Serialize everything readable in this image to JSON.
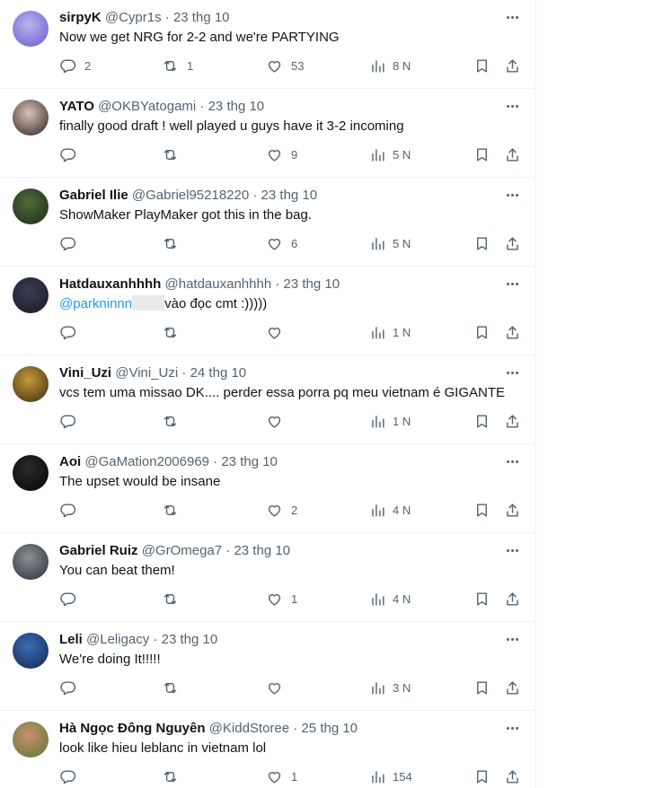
{
  "tweets": [
    {
      "name": "sirpyK",
      "handle": "@Cypr1s",
      "date": "23 thg 10",
      "text": "Now we get NRG for 2-2 and we're PARTYING",
      "replies": "2",
      "retweets": "1",
      "likes": "53",
      "views": "8 N",
      "avatar_colors": [
        "#b9b3f0",
        "#6a5acd"
      ]
    },
    {
      "name": "YATO",
      "handle": "@OKBYatogami",
      "date": "23 thg 10",
      "text": "finally good draft ! well played u guys have it 3-2 incoming",
      "replies": "",
      "retweets": "",
      "likes": "9",
      "views": "5 N",
      "avatar_colors": [
        "#d9c2b8",
        "#2b2020"
      ]
    },
    {
      "name": "Gabriel Ilie",
      "handle": "@Gabriel95218220",
      "date": "23 thg 10",
      "text": "ShowMaker PlayMaker got this in the bag.",
      "replies": "",
      "retweets": "",
      "likes": "6",
      "views": "5 N",
      "avatar_colors": [
        "#4f6b3a",
        "#1e2a18"
      ]
    },
    {
      "name": "Hatdauxanhhhh",
      "handle": "@hatdauxanhhhh",
      "date": "23 thg 10",
      "mention": "@parkninnn",
      "text": "vào đọc cmt :)))))",
      "replies": "",
      "retweets": "",
      "likes": "",
      "views": "1 N",
      "avatar_colors": [
        "#3a3d55",
        "#1a1a24"
      ]
    },
    {
      "name": "Vini_Uzi",
      "handle": "@Vini_Uzi",
      "date": "24 thg 10",
      "text": "vcs tem uma missao DK.... perder essa porra pq meu vietnam é GIGANTE",
      "replies": "",
      "retweets": "",
      "likes": "",
      "views": "1 N",
      "avatar_colors": [
        "#c59a3c",
        "#3b2a10"
      ]
    },
    {
      "name": "Aoi",
      "handle": "@GaMation2006969",
      "date": "23 thg 10",
      "text": "The upset would be insane",
      "replies": "",
      "retweets": "",
      "likes": "2",
      "views": "4 N",
      "avatar_colors": [
        "#2a2a2a",
        "#050505"
      ]
    },
    {
      "name": "Gabriel Ruiz",
      "handle": "@GrOmega7",
      "date": "23 thg 10",
      "text": "You can beat them!",
      "replies": "",
      "retweets": "",
      "likes": "1",
      "views": "4 N",
      "avatar_colors": [
        "#8a8f96",
        "#2b3038"
      ]
    },
    {
      "name": "Leli",
      "handle": "@Leligacy",
      "date": "23 thg 10",
      "text": "We're doing It!!!!!",
      "replies": "",
      "retweets": "",
      "likes": "",
      "views": "3 N",
      "avatar_colors": [
        "#3b6db5",
        "#14284d"
      ]
    },
    {
      "name": "Hà Ngọc Đông Nguyên",
      "handle": "@KiddStoree",
      "date": "25 thg 10",
      "text": "look like hieu leblanc in vietnam lol",
      "replies": "",
      "retweets": "",
      "likes": "1",
      "views": "154",
      "avatar_colors": [
        "#c98f6a",
        "#5a7a3a"
      ]
    }
  ],
  "separator": "·",
  "colors": {
    "text": "#0f1419",
    "secondary": "#536471",
    "link": "#1d9bf0",
    "border": "#eff3f4"
  }
}
